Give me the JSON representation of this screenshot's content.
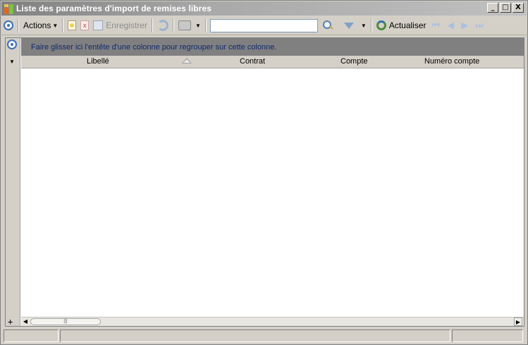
{
  "window": {
    "title": "Liste des paramètres d'import de remises libres",
    "buttons": [
      "_",
      "□",
      "X"
    ]
  },
  "toolbar": {
    "actions_label": "Actions",
    "save_label": "Enregistrer",
    "refresh_label": "Actualiser",
    "search_value": ""
  },
  "grid": {
    "group_hint": "Faire glisser ici l'entête d'une colonne pour regrouper sur cette colonne.",
    "columns": [
      "Libellé",
      "Contrat",
      "Compte",
      "Numéro compte"
    ],
    "rows": [],
    "sorted_column": "Libellé",
    "sort_direction": "ascending"
  },
  "colors": {
    "title_gradient_start": "#808080",
    "group_panel": "#808080",
    "group_text": "#102a70",
    "accent": "#3b6fb6"
  }
}
